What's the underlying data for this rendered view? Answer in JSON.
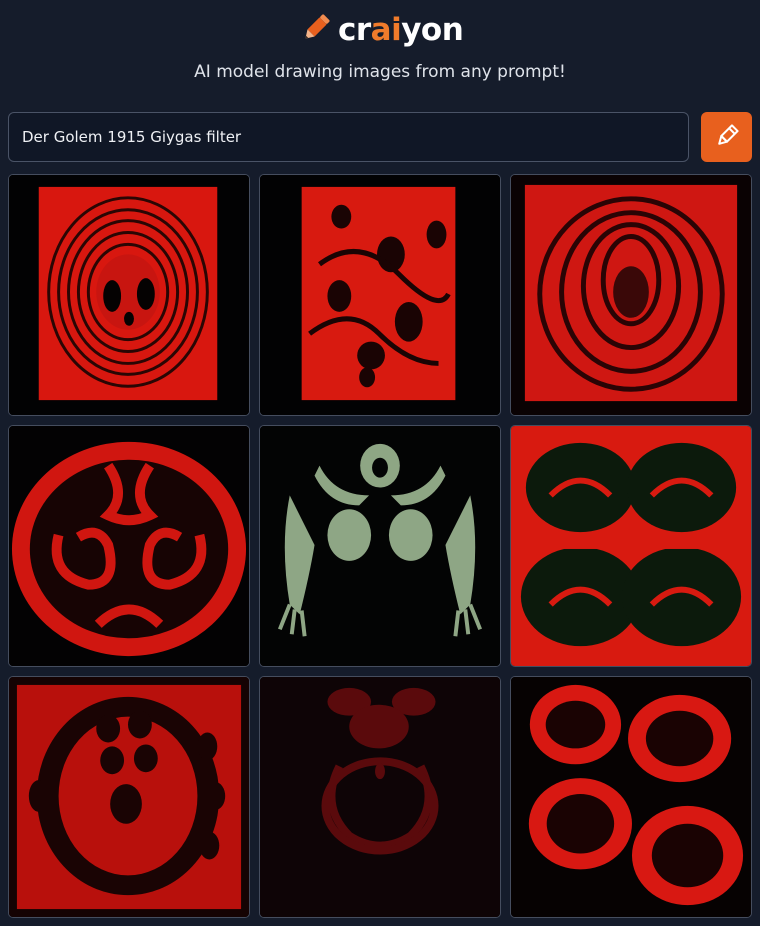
{
  "header": {
    "logo_prefix": "cr",
    "logo_accent": "ai",
    "logo_suffix": "yon",
    "tagline": "AI model drawing images from any prompt!"
  },
  "prompt": {
    "value": "Der Golem 1915 Giygas filter"
  },
  "grid": {
    "images": [
      "giygas-image-1",
      "giygas-image-2",
      "giygas-image-3",
      "giygas-image-4",
      "giygas-image-5",
      "giygas-image-6",
      "giygas-image-7",
      "giygas-image-8",
      "giygas-image-9"
    ]
  },
  "colors": {
    "background": "#151c2b",
    "accent": "#e8601e",
    "image_red": "#e01812",
    "image_green": "#a8c49a"
  }
}
